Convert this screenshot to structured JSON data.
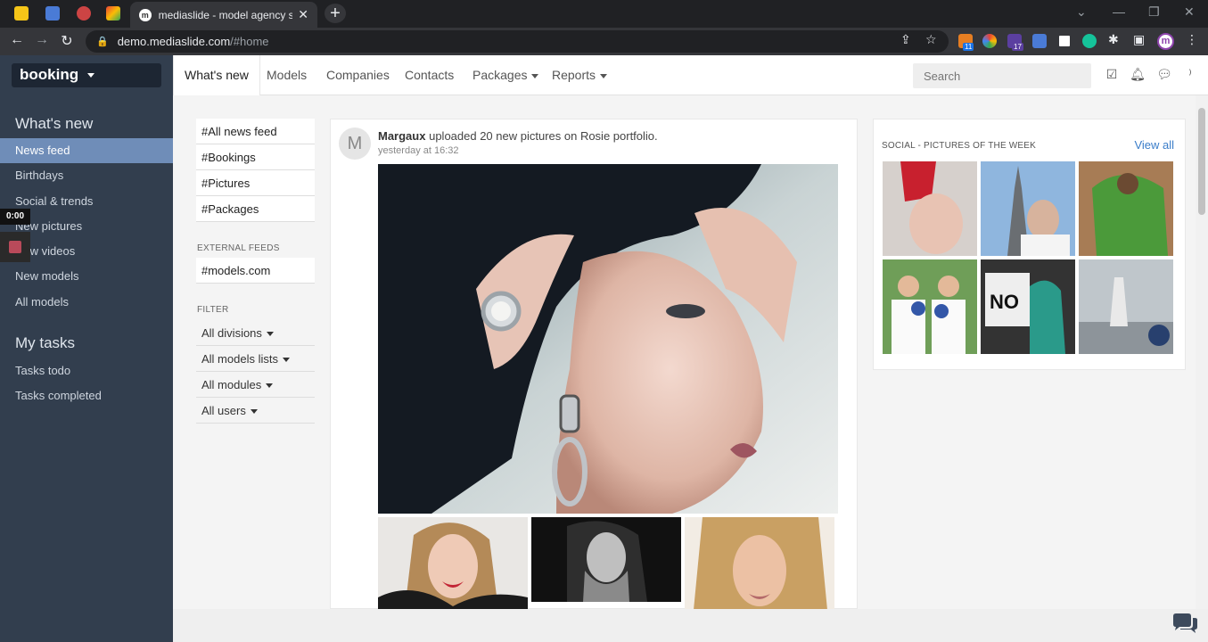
{
  "browser": {
    "tab_title": "mediaslide - model agency softw",
    "url_host": "demo.mediaslide.com",
    "url_path": "/#home",
    "badge_count_1": "11",
    "badge_count_2": "17",
    "profile_initial": "m"
  },
  "sidebar": {
    "brand": "booking",
    "section1": "What's new",
    "section1_items": [
      "News feed",
      "Birthdays",
      "Social & trends",
      "New pictures",
      "New videos",
      "New models",
      "All models"
    ],
    "section2": "My tasks",
    "section2_items": [
      "Tasks todo",
      "Tasks completed"
    ],
    "timer": "0:00"
  },
  "topnav": {
    "items": [
      "What's new",
      "Models",
      "Companies",
      "Contacts",
      "Packages",
      "Reports"
    ],
    "search_placeholder": "Search"
  },
  "feeds": {
    "items": [
      "#All news feed",
      "#Bookings",
      "#Pictures",
      "#Packages"
    ],
    "external_head": "EXTERNAL FEEDS",
    "external_items": [
      "#models.com"
    ],
    "filter_head": "FILTER",
    "filters": [
      "All divisions",
      "All models lists",
      "All modules",
      "All users"
    ]
  },
  "post": {
    "avatar_letter": "M",
    "author": "Margaux",
    "action": "uploaded 20 new pictures on Rosie portfolio.",
    "time": "yesterday at 16:32"
  },
  "social": {
    "title": "SOCIAL - PICTURES OF THE WEEK",
    "view_all": "View all"
  },
  "colors": {
    "sidebar_bg": "#323e4e",
    "sidebar_active": "#6f8db8",
    "link": "#3a7dc9"
  }
}
